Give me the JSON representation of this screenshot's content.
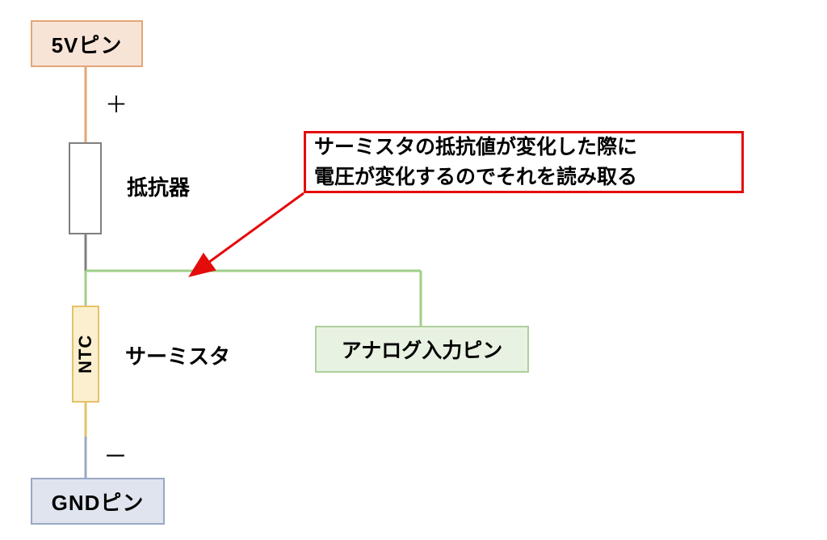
{
  "blocks": {
    "pin_5v": "5Vピン",
    "resistor_label": "抵抗器",
    "ntc_text": "NTC",
    "thermistor_label": "サーミスタ",
    "analog_pin": "アナログ入力ピン",
    "gnd_pin": "GNDピン"
  },
  "symbols": {
    "plus": "＋",
    "minus": "－"
  },
  "callout": {
    "line1": "サーミスタの抵抗値が変化した際に",
    "line2": "電圧が変化するのでそれを読み取る"
  },
  "colors": {
    "wire_orange": "#e3a677",
    "wire_gray": "#7f7f7f",
    "wire_green": "#9fcf88",
    "wire_yellow": "#e5c267",
    "wire_blue": "#9aa8c6",
    "arrow_red": "#e40b0b"
  },
  "chart_data": {
    "type": "diagram",
    "nodes": [
      {
        "id": "pin_5v",
        "label": "5Vピン",
        "kind": "pin-5v"
      },
      {
        "id": "resistor",
        "label": "抵抗器",
        "kind": "resistor"
      },
      {
        "id": "ntc",
        "label": "NTC サーミスタ",
        "kind": "thermistor-ntc"
      },
      {
        "id": "analog_in",
        "label": "アナログ入力ピン",
        "kind": "pin-analog-input"
      },
      {
        "id": "gnd",
        "label": "GNDピン",
        "kind": "pin-gnd"
      }
    ],
    "edges": [
      {
        "from": "pin_5v",
        "to": "resistor",
        "polarity": "+"
      },
      {
        "from": "resistor",
        "to": "ntc",
        "tap_to": "analog_in"
      },
      {
        "from": "ntc",
        "to": "gnd",
        "polarity": "-"
      }
    ],
    "annotation": {
      "target_edge": {
        "from": "resistor",
        "to": "ntc"
      },
      "text": "サーミスタの抵抗値が変化した際に電圧が変化するのでそれを読み取る"
    }
  }
}
